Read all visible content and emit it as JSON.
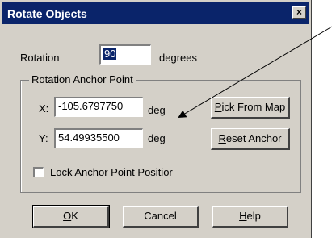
{
  "window": {
    "title": "Rotate Objects",
    "close_label": "×"
  },
  "rotation": {
    "label": "Rotation",
    "value": "90",
    "unit": "degrees"
  },
  "anchor_group": {
    "title": "Rotation Anchor Point",
    "x_label": "X:",
    "x_value": "-105.6797750",
    "x_unit": "deg",
    "y_label": "Y:",
    "y_value": "54.49935500",
    "y_unit": "deg",
    "pick_from_map_label": "ick From Map",
    "pick_from_map_mnemonic": "P",
    "reset_anchor_label": "eset Anchor",
    "reset_anchor_mnemonic": "R",
    "lock_label": "ock Anchor Point Positior",
    "lock_mnemonic": "L",
    "lock_checked": false
  },
  "buttons": {
    "ok_label": "K",
    "ok_mnemonic": "O",
    "cancel_label": "Cancel",
    "help_label": "elp",
    "help_mnemonic": "H"
  }
}
